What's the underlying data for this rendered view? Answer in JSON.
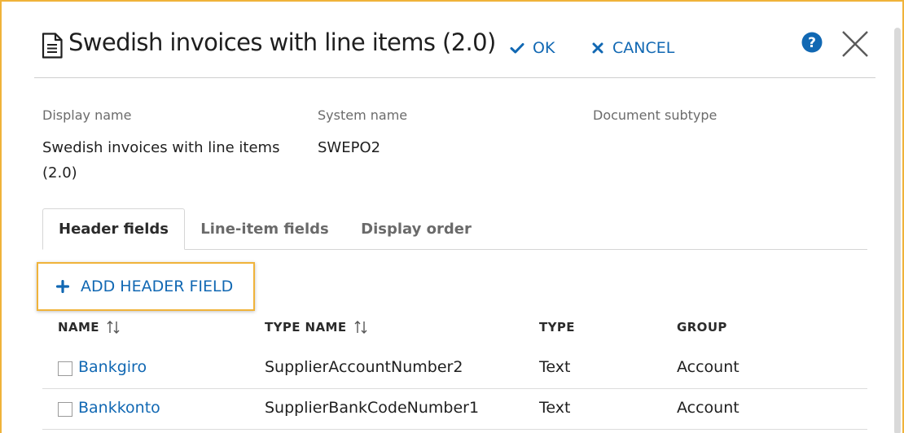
{
  "dialog": {
    "title": "Swedish invoices with line items (2.0)",
    "ok_label": "OK",
    "cancel_label": "CANCEL",
    "icons": {
      "document": "document-icon",
      "ok": "checkmark-icon",
      "cancel": "x-icon",
      "help": "help-icon",
      "close": "close-icon"
    },
    "accent_color": "#1168b3",
    "highlight_color": "#f0b33a"
  },
  "properties": {
    "display_name_label": "Display name",
    "display_name_value": "Swedish invoices with line items (2.0)",
    "system_name_label": "System name",
    "system_name_value": "SWEPO2",
    "document_subtype_label": "Document subtype",
    "document_subtype_value": ""
  },
  "tabs": [
    {
      "label": "Header fields",
      "active": true
    },
    {
      "label": "Line-item fields",
      "active": false
    },
    {
      "label": "Display order",
      "active": false
    }
  ],
  "add_button": {
    "label": "ADD HEADER FIELD",
    "icon": "plus-icon"
  },
  "table": {
    "columns": [
      {
        "label": "NAME",
        "sortable": true
      },
      {
        "label": "TYPE NAME",
        "sortable": true
      },
      {
        "label": "TYPE",
        "sortable": false
      },
      {
        "label": "GROUP",
        "sortable": false
      }
    ],
    "rows": [
      {
        "name": "Bankgiro",
        "type_name": "SupplierAccountNumber2",
        "type": "Text",
        "group": "Account",
        "checked": false
      },
      {
        "name": "Bankkonto",
        "type_name": "SupplierBankCodeNumber1",
        "type": "Text",
        "group": "Account",
        "checked": false
      }
    ]
  }
}
